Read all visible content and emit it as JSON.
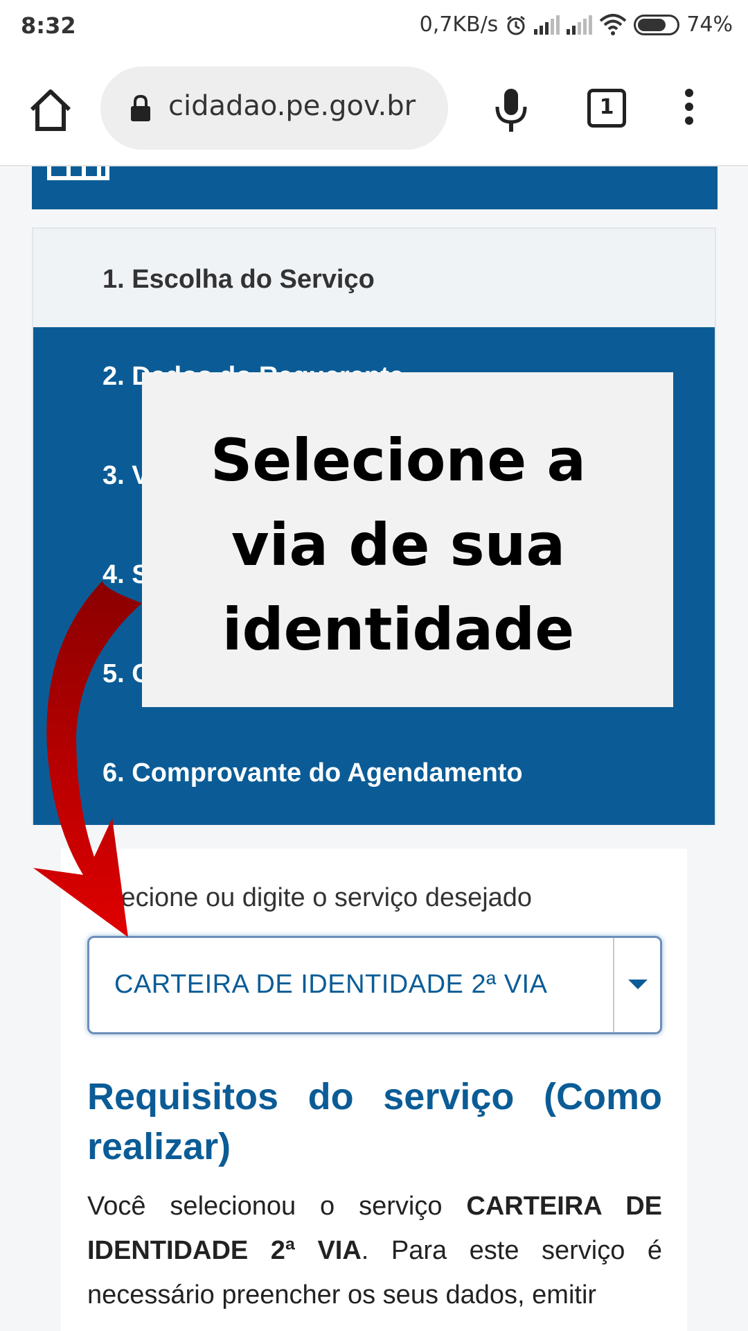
{
  "status_bar": {
    "time": "8:32",
    "network_speed": "0,7KB/s",
    "battery": "74%",
    "icons": [
      "alarm-icon",
      "signal-icon",
      "signal-icon",
      "wifi-icon",
      "battery-icon"
    ]
  },
  "browser": {
    "url": "cidadao.pe.gov.br",
    "tab_count": "1",
    "icons": [
      "home-icon",
      "lock-icon",
      "microphone-icon",
      "tabs-icon",
      "more-vert-icon"
    ]
  },
  "steps": [
    {
      "label": "1. Escolha do Serviço"
    },
    {
      "label": "2. Dados do Requerente"
    },
    {
      "label": "3. V"
    },
    {
      "label": "4. S"
    },
    {
      "label": "5. C"
    },
    {
      "label": "6. Comprovante do Agendamento"
    }
  ],
  "form": {
    "field_label": "lecione ou digite o serviço desejado",
    "selected_value": "CARTEIRA DE IDENTIDADE 2ª VIA"
  },
  "requirements": {
    "title": "Requisitos do serviço (Como realizar)",
    "text_prefix": "Você selecionou o serviço ",
    "text_bold": "CARTEIRA DE IDENTIDADE 2ª VIA",
    "text_suffix": ". Para este serviço é necessário preencher os seus dados, emitir"
  },
  "overlay": {
    "line1": "Selecione a",
    "line2": "via de sua",
    "line3": "identidade"
  },
  "colors": {
    "brand_blue": "#0b5c96",
    "arrow_red": "#d40000"
  }
}
